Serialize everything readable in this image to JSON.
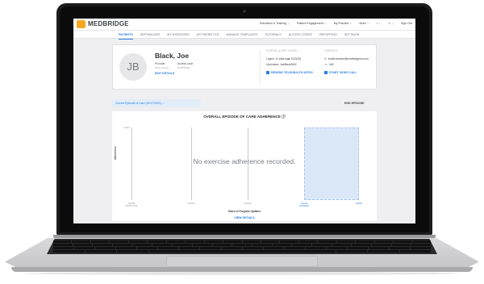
{
  "app": {
    "brand": "MEDBRIDGE",
    "accent": "#2a7de1",
    "brand_color": "#f6a623"
  },
  "topnav": {
    "items": [
      "Education & Training ⌄",
      "Patient Engagement ⌄",
      "My Practice ⌄",
      "More ⌄"
    ],
    "notifications_icon": "chat-icon",
    "user_icon": "user-icon",
    "sign_out": "Sign Out"
  },
  "subnav": {
    "items": [
      "PATIENTS",
      "HEP BUILDER",
      "MY EXERCISES",
      "MY PATIENT ED",
      "MANAGE TEMPLATES",
      "TUTORIALS",
      "ACCESS CODES",
      "REPORTING",
      "SETTINGS"
    ],
    "active": "PATIENTS"
  },
  "patient": {
    "initials": "JB",
    "name": "Black, Joe",
    "provider_label": "Provider",
    "provider_value": "Steve Demo",
    "access_label": "Access code",
    "access_value": "B7ZP7D4Q",
    "edit_label": "EDIT DETAILS"
  },
  "portal": {
    "heading": "PORTAL & APP LOGIN",
    "logins": "Logins: 14 (last login 6/23/20)",
    "username": "Username: JoeBlack2602",
    "resend": "RESEND TELEHEALTH INTRO"
  },
  "contact": {
    "heading": "CONTACT",
    "email": "emilie.bessert@medbridgeed.com",
    "phone": "N/A",
    "video": "START VIDEO CALL"
  },
  "episode": {
    "selector": "Current Episode of Care (02/17/2020)  ⌄",
    "end": "END EPISODE"
  },
  "chart": {
    "title": "OVERALL EPISODE OF CARE ADHERENCE ⓘ",
    "y_axis": "Adherence",
    "y_tick": "100%",
    "empty_message": "No exercise adherence recorded.",
    "x_axis": "Dates of Program Updates",
    "view_details": "VIEW DETAILS",
    "x_ticks": [
      {
        "date": "2/16/20",
        "note": "INITIAL EVAL"
      },
      {
        "date": "2/16/20",
        "note": ""
      },
      {
        "date": "2/16/20",
        "note": ""
      },
      {
        "date": "6/27/20",
        "note": "CURRENT"
      },
      {
        "date": "TODAY",
        "note": ""
      }
    ]
  },
  "chart_data": {
    "type": "line",
    "title": "OVERALL EPISODE OF CARE ADHERENCE",
    "xlabel": "Dates of Program Updates",
    "ylabel": "Adherence",
    "categories": [
      "2/16/20 INITIAL EVAL",
      "2/16/20",
      "2/16/20",
      "6/27/20 CURRENT",
      "TODAY"
    ],
    "series": [],
    "ylim": [
      0,
      100
    ],
    "annotations": [
      "No exercise adherence recorded."
    ]
  }
}
